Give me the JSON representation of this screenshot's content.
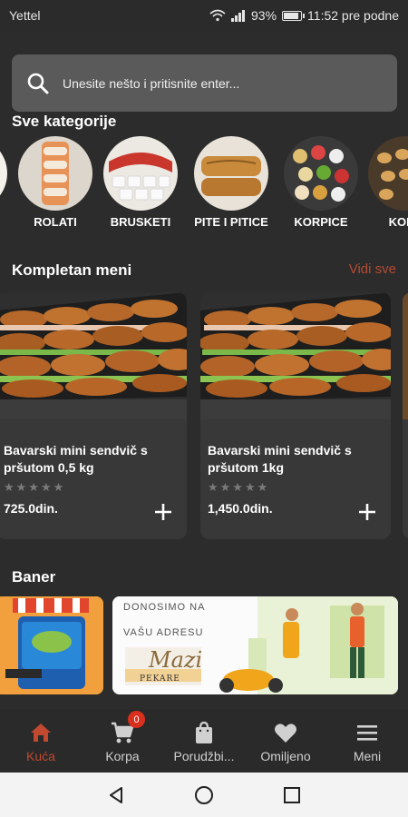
{
  "status_bar": {
    "carrier": "Yettel",
    "battery": "93%",
    "time": "11:52 pre podne",
    "battery_level": 0.93
  },
  "search": {
    "placeholder": "Unesite nešto i pritisnite enter..."
  },
  "categories": {
    "title": "Sve kategorije",
    "items": [
      {
        "label": "ROLATI"
      },
      {
        "label": "BRUSKETI"
      },
      {
        "label": "PITE I PITICE"
      },
      {
        "label": "KORPICE"
      },
      {
        "label": "KOKT"
      }
    ]
  },
  "menu": {
    "title": "Kompletan meni",
    "see_all": "Vidi sve",
    "items": [
      {
        "name": "Bavarski mini sendvič s pršutom 0,5 kg",
        "price": "725.0din.",
        "rating": 0
      },
      {
        "name": "Bavarski mini sendvič s pršutom 1kg",
        "price": "1,450.0din.",
        "rating": 0
      }
    ]
  },
  "banners": {
    "title": "Baner",
    "items": [
      {
        "text_1": "DONOSIMO NA",
        "text_2": "VAŠU ADRESU",
        "logo_text": "Mazi",
        "logo_sub": "PEKARE"
      }
    ]
  },
  "bottom_nav": {
    "items": [
      {
        "label": "Kuća",
        "icon": "home-icon",
        "active": true
      },
      {
        "label": "Korpa",
        "icon": "cart-icon",
        "badge": "0"
      },
      {
        "label": "Porudžbi...",
        "icon": "bag-icon"
      },
      {
        "label": "Omiljeno",
        "icon": "heart-icon"
      },
      {
        "label": "Meni",
        "icon": "menu-icon"
      }
    ]
  },
  "colors": {
    "accent": "#c0492f",
    "background": "#2c2c2c",
    "card": "#383838",
    "badge": "#d9301e"
  }
}
